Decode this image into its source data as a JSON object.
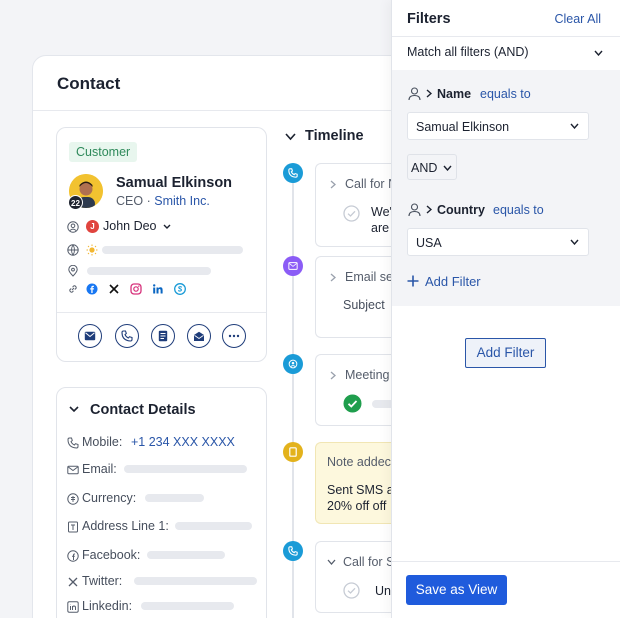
{
  "contact": {
    "title": "Contact",
    "card": {
      "badge": "Customer",
      "avatar_number": "22",
      "name": "Samual Elkinson",
      "role": "CEO",
      "separator": "·",
      "company": "Smith Inc.",
      "owner_initial": "J",
      "owner_name": "John Deo",
      "social_icons": [
        "facebook-icon",
        "x-icon",
        "instagram-icon",
        "linkedin-icon",
        "skype-icon"
      ],
      "actions": [
        "email-icon",
        "phone-icon",
        "notes-icon",
        "mail-icon",
        "more-icon"
      ]
    },
    "details": {
      "title": "Contact Details",
      "mobile_label": "Mobile:",
      "mobile_value": "+1 234 XXX XXXX",
      "email_label": "Email:",
      "currency_label": "Currency:",
      "address_label": "Address Line 1:",
      "facebook_label": "Facebook:",
      "twitter_label": "Twitter:",
      "linkedin_label": "Linkedin:"
    }
  },
  "timeline": {
    "title": "Timeline",
    "items": [
      {
        "type": "call",
        "color": "#1a9bd7",
        "header": "Call for N",
        "body": [
          "We'",
          "are"
        ]
      },
      {
        "type": "email",
        "color": "#8b5cf6",
        "header": "Email se",
        "body": [
          "Subject"
        ]
      },
      {
        "type": "meeting",
        "color": "#1a9bd7",
        "header": "Meeting"
      },
      {
        "type": "note",
        "color": "#e3b21c",
        "header": "Note addec",
        "body": [
          "Sent SMS a",
          "20% off off"
        ]
      },
      {
        "type": "call",
        "color": "#1a9bd7",
        "header": "Call for S",
        "body": [
          "Un"
        ]
      }
    ]
  },
  "filters": {
    "title": "Filters",
    "clear_all": "Clear All",
    "match": "Match all filters (AND)",
    "rules": [
      {
        "field": "Name",
        "operator": "equals to",
        "value": "Samual Elkinson"
      },
      {
        "field": "Country",
        "operator": "equals to",
        "value": "USA"
      }
    ],
    "joiner": "AND",
    "add_filter_link": "Add Filter",
    "add_filter_button": "Add Filter",
    "save_view": "Save as View"
  }
}
